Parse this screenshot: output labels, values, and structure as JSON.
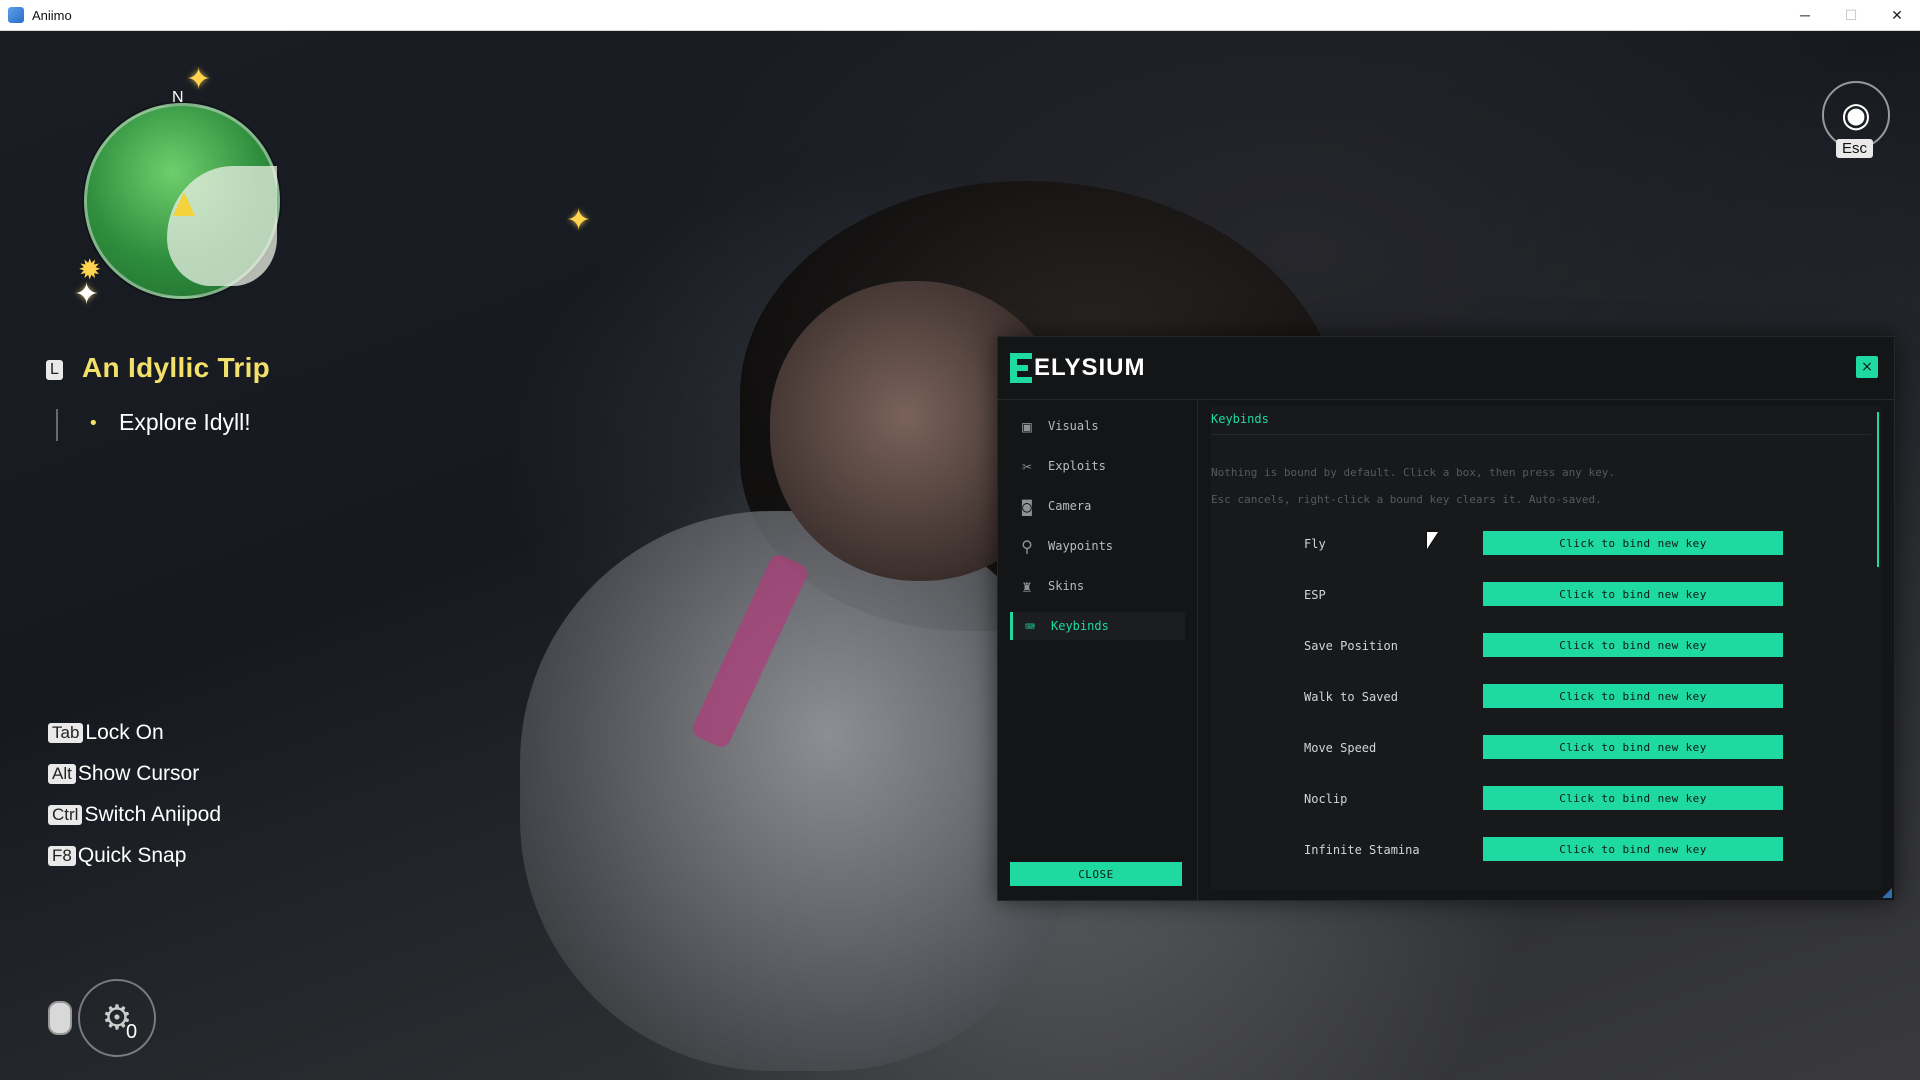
{
  "window": {
    "title": "Aniimo",
    "controls": {
      "minimize": "─",
      "maximize": "☐",
      "close": "✕"
    }
  },
  "hud": {
    "compass_letter": "N",
    "quest": {
      "key": "L",
      "title": "An Idyllic Trip",
      "step": "Explore Idyll!"
    },
    "hotkeys": [
      {
        "key": "Tab",
        "label": "Lock On"
      },
      {
        "key": "Alt",
        "label": "Show Cursor"
      },
      {
        "key": "Ctrl",
        "label": "Switch Aniipod"
      },
      {
        "key": "F8",
        "label": "Quick Snap"
      }
    ],
    "counter": "0",
    "esc_label": "Esc"
  },
  "panel": {
    "brand": "ELYSIUM",
    "close_x": "×",
    "nav": [
      {
        "label": "Visuals",
        "icon": "image-icon"
      },
      {
        "label": "Exploits",
        "icon": "tools-icon"
      },
      {
        "label": "Camera",
        "icon": "camera-icon"
      },
      {
        "label": "Waypoints",
        "icon": "map-pin-icon"
      },
      {
        "label": "Skins",
        "icon": "shirt-icon"
      },
      {
        "label": "Keybinds",
        "icon": "keyboard-icon",
        "active": true
      }
    ],
    "close_button": "CLOSE",
    "content": {
      "title": "Keybinds",
      "hint_line1": "Nothing is bound by default. Click a box, then press any key.",
      "hint_line2": "Esc cancels, right-click a bound key clears it. Auto-saved.",
      "binds": [
        {
          "label": "Fly",
          "button": "Click to bind new key"
        },
        {
          "label": "ESP",
          "button": "Click to bind new key"
        },
        {
          "label": "Save Position",
          "button": "Click to bind new key"
        },
        {
          "label": "Walk to Saved",
          "button": "Click to bind new key"
        },
        {
          "label": "Move Speed",
          "button": "Click to bind new key"
        },
        {
          "label": "Noclip",
          "button": "Click to bind new key"
        },
        {
          "label": "Infinite Stamina",
          "button": "Click to bind new key"
        }
      ]
    }
  },
  "colors": {
    "accent": "#1fd9a3",
    "quest_yellow": "#f3e06a"
  }
}
